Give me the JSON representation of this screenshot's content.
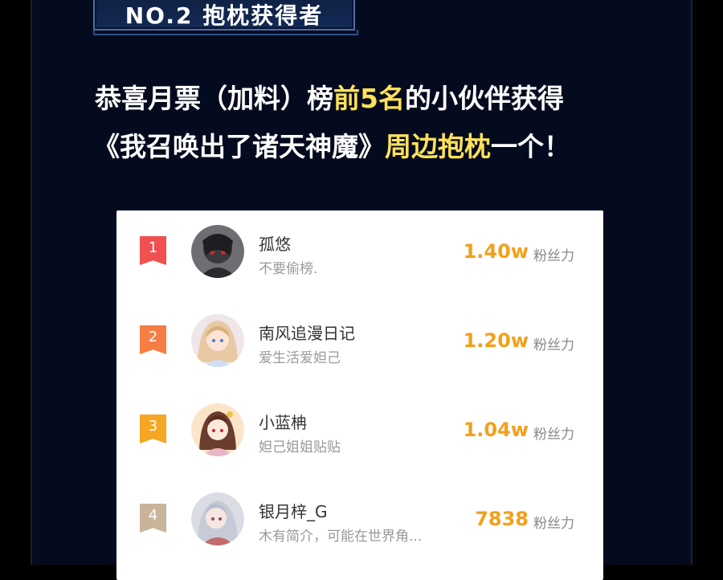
{
  "colors": {
    "background": "#050b1e",
    "highlight": "#ffe15a",
    "score": "#f2a01b",
    "rank1": "#f05050",
    "rank2": "#f57e45",
    "rank3": "#f5a623",
    "rank4": "#c9b49a"
  },
  "badge": {
    "text": "NO.2 抱枕获得者"
  },
  "headline": {
    "line1": {
      "pre": "恭喜月票（加料）榜",
      "hl": "前5名",
      "post": "的小伙伴获得"
    },
    "line2": {
      "pre": "《我召唤出了诸天神魔》",
      "hl": "周边抱枕",
      "post": "一个！"
    }
  },
  "ranking": [
    {
      "rank": "1",
      "name": "孤悠",
      "sub": "不要偷榜.",
      "score": "1.40w",
      "unit": "粉丝力",
      "avatar_icon": "avatar-dark-icon"
    },
    {
      "rank": "2",
      "name": "南风追漫日记",
      "sub": "爱生活爱妲己",
      "score": "1.20w",
      "unit": "粉丝力",
      "avatar_icon": "avatar-anime-girl-icon"
    },
    {
      "rank": "3",
      "name": "小蓝柟",
      "sub": "妲己姐姐贴贴",
      "score": "1.04w",
      "unit": "粉丝力",
      "avatar_icon": "avatar-anime-girl-icon"
    },
    {
      "rank": "4",
      "name": "银月梓_G",
      "sub": "木有简介，可能在世界角...",
      "score": "7838",
      "unit": "粉丝力",
      "avatar_icon": "avatar-anime-girl-icon"
    }
  ]
}
